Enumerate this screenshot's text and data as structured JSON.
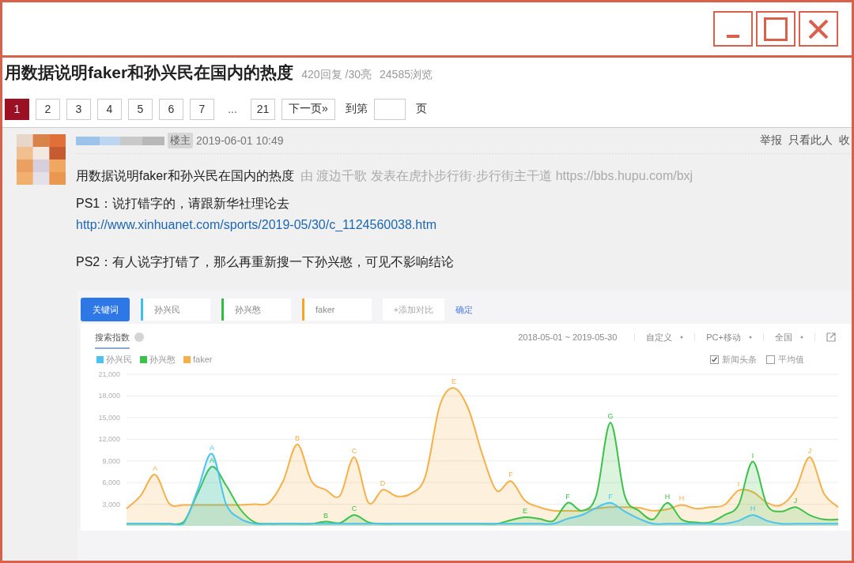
{
  "window": {
    "controls": [
      {
        "kind": "minimize"
      },
      {
        "kind": "maximize"
      },
      {
        "kind": "close"
      }
    ]
  },
  "thread": {
    "title": "用数据说明faker和孙兴民在国内的热度",
    "replies": "420回复",
    "lights": "/30亮",
    "views": "24585浏览"
  },
  "pagination": {
    "pages": [
      {
        "label": "1",
        "selected": true
      },
      {
        "label": "2",
        "selected": false
      },
      {
        "label": "3",
        "selected": false
      },
      {
        "label": "4",
        "selected": false
      },
      {
        "label": "5",
        "selected": false
      },
      {
        "label": "6",
        "selected": false
      },
      {
        "label": "7",
        "selected": false
      }
    ],
    "ellipsis": "...",
    "last": {
      "label": "21",
      "selected": false
    },
    "next": "下一页»",
    "goto_prefix": "到第",
    "goto_suffix": "页"
  },
  "post": {
    "badge": "楼主",
    "date": "2019-06-01 10:49",
    "actions": [
      "举报",
      "只看此人",
      "收"
    ],
    "headline": "用数据说明faker和孙兴民在国内的热度",
    "source": "由  渡边千歌 发表在虎扑步行街·步行街主干道 https://bbs.hupu.com/bxj",
    "paragraphs": [
      [
        {
          "kind": "text",
          "text": "PS1：说打错字的，请跟新华社理论去"
        },
        {
          "kind": "link",
          "text": "http://www.xinhuanet.com/sports/2019-05/30/c_1124560038.htm"
        }
      ],
      [
        {
          "kind": "text",
          "text": "PS2：有人说字打错了，那么再重新搜一下孙兴憨，可见不影响结论"
        }
      ]
    ]
  },
  "embedded": {
    "keyword_button": "关键词",
    "keywords": [
      {
        "text": "孙兴民",
        "color": "#3cc0e8"
      },
      {
        "text": "孙兴憨",
        "color": "#2fbf3f"
      },
      {
        "text": "faker",
        "color": "#f5a623"
      }
    ],
    "add": "+添加对比",
    "confirm": "确定",
    "card": {
      "tab": "搜索指数",
      "date_range": "2018-05-01 ~ 2019-05-30",
      "filters": [
        "自定义",
        "PC+移动",
        "全国"
      ],
      "options": [
        {
          "label": "新闻头条",
          "checked": true
        },
        {
          "label": "平均值",
          "checked": false
        }
      ],
      "chart_data": {
        "type": "area",
        "grid": true,
        "series": [
          {
            "name": "孙兴民",
            "color": "#4cc3ee",
            "values": [
              300,
              300,
              300,
              300,
              300,
              5000,
              10000,
              3000,
              1000,
              300,
              300,
              300,
              300,
              300,
              300,
              300,
              300,
              300,
              300,
              300,
              300,
              300,
              300,
              300,
              300,
              300,
              300,
              300,
              300,
              300,
              300,
              1000,
              1500,
              2500,
              3200,
              2000,
              1000,
              300,
              300,
              300,
              300,
              300,
              300,
              700,
              1500,
              700,
              300,
              300,
              300,
              300,
              300
            ]
          },
          {
            "name": "孙兴憨",
            "color": "#3cc24a",
            "values": [
              300,
              300,
              300,
              300,
              500,
              4500,
              8200,
              5600,
              2300,
              500,
              300,
              300,
              300,
              300,
              600,
              400,
              1500,
              500,
              300,
              300,
              300,
              300,
              300,
              300,
              300,
              300,
              300,
              800,
              1200,
              1000,
              700,
              3200,
              2100,
              4200,
              14300,
              4200,
              2100,
              900,
              3200,
              900,
              500,
              500,
              1500,
              2900,
              8900,
              2900,
              2000,
              2600,
              1500,
              900,
              900
            ]
          },
          {
            "name": "faker",
            "color": "#f5b04a",
            "values": [
              2400,
              4200,
              7100,
              3100,
              2900,
              2900,
              2900,
              2900,
              2900,
              3000,
              3200,
              6200,
              11300,
              6200,
              5000,
              4200,
              9500,
              3200,
              5000,
              4100,
              4500,
              6900,
              16600,
              19100,
              16300,
              9900,
              4900,
              6200,
              3500,
              2600,
              2100,
              2100,
              2100,
              2400,
              2600,
              2600,
              2500,
              2100,
              2300,
              2900,
              2400,
              2600,
              2900,
              4900,
              4700,
              3200,
              2900,
              5000,
              9500,
              4500,
              2600
            ]
          }
        ],
        "ylim": [
          0,
          21000
        ],
        "yticks": [
          {
            "value": 3000,
            "label": "3,000"
          },
          {
            "value": 6000,
            "label": "6,000"
          },
          {
            "value": 9000,
            "label": "9,000"
          },
          {
            "value": 12000,
            "label": "12,000"
          },
          {
            "value": 15000,
            "label": "15,000"
          },
          {
            "value": 18000,
            "label": "18,000"
          },
          {
            "value": 21000,
            "label": "21,000"
          }
        ]
      },
      "peak_labels": [
        {
          "labels": [
            "A",
            "F",
            "H"
          ]
        },
        {
          "labels": [
            "A",
            "B",
            "C",
            "E",
            "F",
            "G",
            "H",
            "I",
            "J"
          ]
        },
        {
          "labels": [
            "A",
            "B",
            "C",
            "D",
            "E",
            "F",
            "H",
            "I",
            "J"
          ]
        }
      ]
    }
  }
}
